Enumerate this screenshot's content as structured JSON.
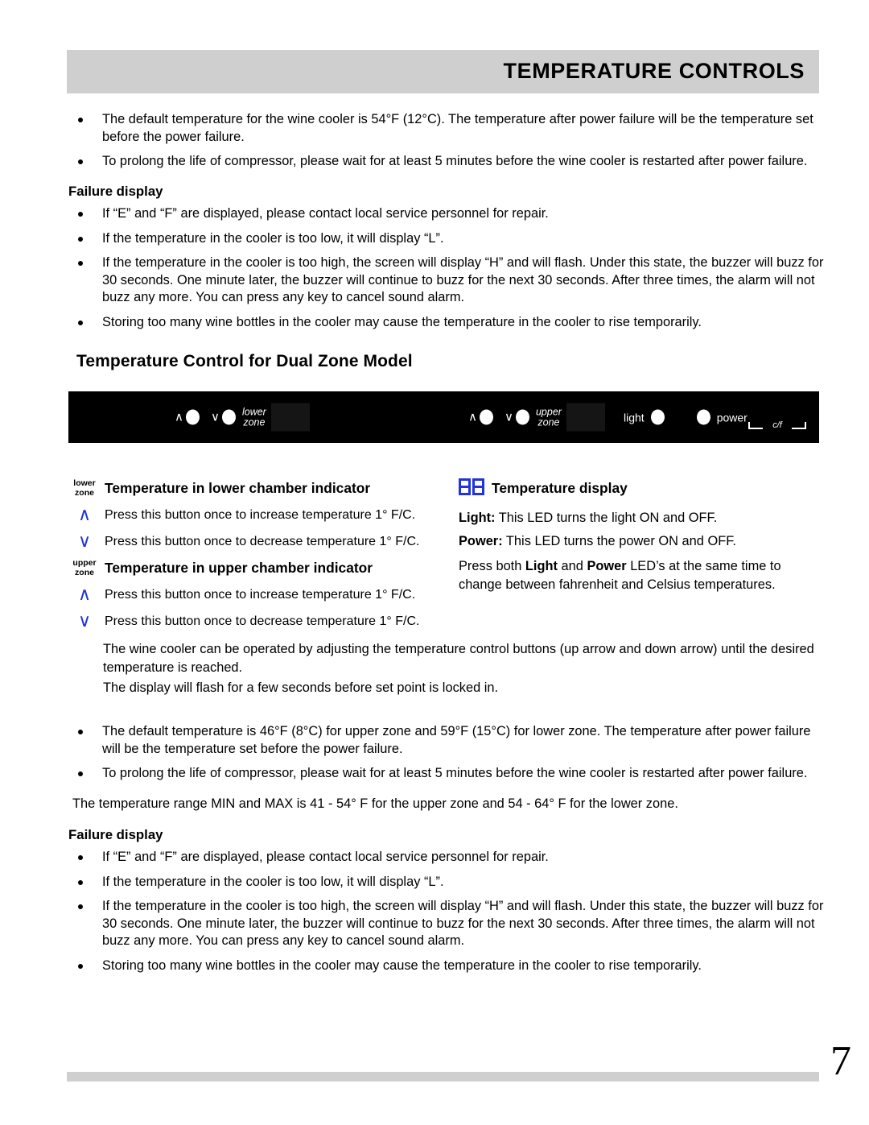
{
  "header": {
    "title": "TEMPERATURE CONTROLS"
  },
  "intro_bullets": [
    "The default temperature for the wine cooler is 54°F (12°C). The temperature after power failure will be the temperature set before the power failure.",
    "To prolong the life of compressor, please wait for at least 5 minutes before the wine cooler is restarted after power failure."
  ],
  "failure_display_1": {
    "heading": "Failure display",
    "bullets": [
      "If “E” and “F” are displayed, please contact local service personnel for repair.",
      "If the temperature in the cooler is too low, it will display “L”.",
      "If the temperature in the cooler is too high, the screen will display “H” and will flash. Under this state, the buzzer will buzz for 30 seconds. One minute later, the buzzer will continue to buzz for the next 30 seconds. After three times, the alarm will not buzz any more. You can press any key to cancel sound alarm.",
      "Storing too many wine bottles in the cooler may cause the temperature in the cooler to rise temporarily."
    ]
  },
  "section_title": "Temperature Control for Dual Zone Model",
  "control_panel": {
    "lower_group": {
      "up_chevron": "∧",
      "down_chevron": "∨",
      "zone_label_line1": "lower",
      "zone_label_line2": "zone"
    },
    "upper_group": {
      "up_chevron": "∧",
      "down_chevron": "∨",
      "zone_label_line1": "upper",
      "zone_label_line2": "zone"
    },
    "light_label": "light",
    "power_label": "power",
    "cf_label": "c/f"
  },
  "legend_left": [
    {
      "key_line1": "lower",
      "key_line2": "zone",
      "key_type": "zone",
      "text": "Temperature in lower chamber indicator",
      "bold": true
    },
    {
      "key_glyph": "∧",
      "key_type": "chevron",
      "text": "Press this button once to increase temperature 1° F/C.",
      "bold": false
    },
    {
      "key_glyph": "∨",
      "key_type": "chevron",
      "text": "Press this button once to decrease temperature 1° F/C.",
      "bold": false
    },
    {
      "key_line1": "upper",
      "key_line2": "zone",
      "key_type": "zone",
      "text": "Temperature in upper chamber indicator",
      "bold": true
    },
    {
      "key_glyph": "∧",
      "key_type": "chevron",
      "text": "Press this button once to increase temperature 1° F/C.",
      "bold": false
    },
    {
      "key_glyph": "∨",
      "key_type": "chevron",
      "text": "Press this button once to decrease temperature 1° F/C.",
      "bold": false
    }
  ],
  "legend_right": {
    "display_heading": "Temperature display",
    "light_label": "Light:",
    "light_text": "This LED turns the light ON and OFF.",
    "power_label": "Power:",
    "power_text": "This LED turns the power ON and OFF.",
    "combo_pre": "Press both ",
    "combo_b1": "Light",
    "combo_mid": " and ",
    "combo_b2": "Power",
    "combo_post": " LED’s at the same time to change between fahrenheit and Celsius temperatures."
  },
  "mid_paragraphs": [
    "The wine cooler can be operated by adjusting the temperature control buttons (up arrow and down arrow) until the desired temperature is reached.",
    "The display will flash for a few seconds before set point is locked in."
  ],
  "dual_bullets": [
    "The default temperature is 46°F (8°C) for upper zone and 59°F (15°C) for lower zone. The temperature after power failure will be the temperature set before the power failure.",
    "To prolong the life of compressor, please wait for at least 5 minutes before the wine cooler is restarted after power failure."
  ],
  "range_paragraph": "The temperature range MIN and MAX is 41 - 54° F for the upper zone and 54 - 64° F for the lower zone.",
  "failure_display_2": {
    "heading": "Failure display",
    "bullets": [
      "If “E” and “F” are displayed, please contact local service personnel for repair.",
      "If the temperature in the cooler is too low, it will display “L”.",
      "If the temperature in the cooler is too high, the screen will display “H” and will flash. Under this state, the buzzer will buzz for 30 seconds. One minute later, the buzzer will continue to buzz for the next 30 seconds. After three times, the alarm will not buzz any more. You can press any key to cancel sound alarm.",
      "Storing too many wine bottles in the cooler may cause the temperature in the cooler to rise temporarily."
    ]
  },
  "footer": {
    "page_number": "7"
  },
  "colors": {
    "bar_gray": "#cfcfcf",
    "panel_black": "#000000",
    "led_blue": "#2233dd"
  }
}
